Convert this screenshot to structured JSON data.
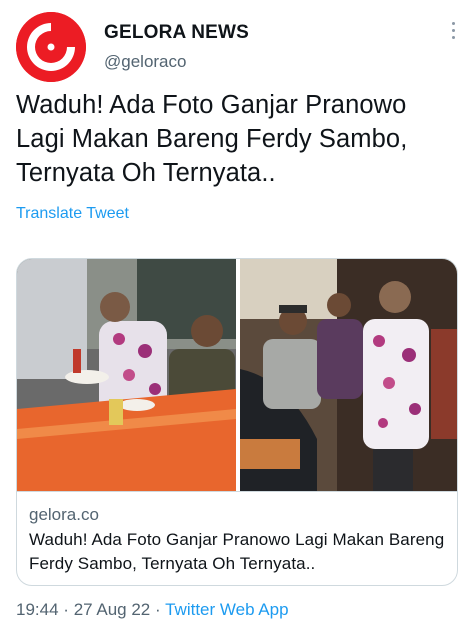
{
  "account": {
    "display_name": "GELORA NEWS",
    "handle": "@geloraco",
    "avatar_icon": "gelora-logo-icon",
    "brand_color": "#ec1c24"
  },
  "tweet": {
    "text": "Waduh! Ada Foto Ganjar Pranowo Lagi Makan Bareng Ferdy Sambo, Ternyata Oh Ternyata..",
    "translate_label": "Translate Tweet"
  },
  "card": {
    "domain": "gelora.co",
    "title": "Waduh! Ada Foto Ganjar Pranowo Lagi Makan Bareng Ferdy Sambo, Ternyata Oh Ternyata.."
  },
  "meta": {
    "time": "19:44",
    "separator": "·",
    "date": "27 Aug 22",
    "app": "Twitter Web App"
  },
  "colors": {
    "link": "#1d9bf0",
    "secondary_text": "#536471",
    "border": "#cfd9de"
  }
}
